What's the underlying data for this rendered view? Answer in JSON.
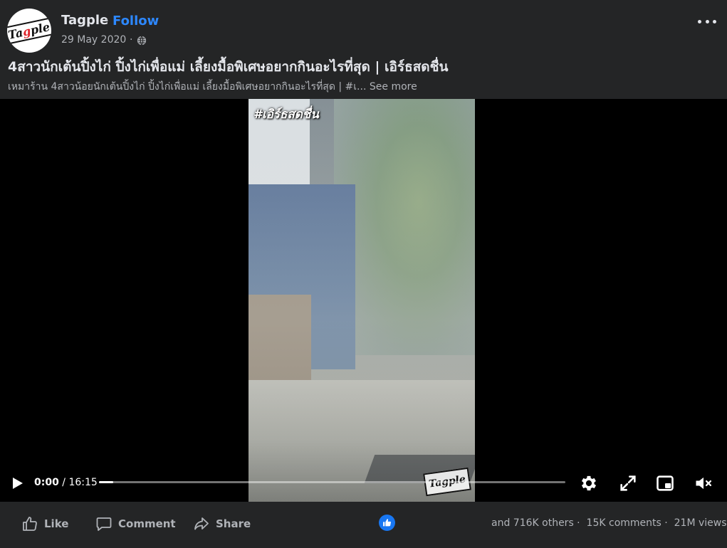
{
  "page": {
    "name": "Tagple",
    "name_separator": "·",
    "follow_label": "Follow",
    "date": "29 May 2020",
    "date_separator": "·",
    "avatar_logo_text": "Tagple"
  },
  "post": {
    "title": "4สาวนักเต้นปิ้งไก่ ปิ้งไก่เพื่อแม่ เลี้ยงมื้อพิเศษอยากกินอะไรที่สุด | เอิร์ธสดชื่น",
    "description": "เหมาร้าน 4สาวน้อยนักเต้นปิ้งไก่ ปิ้งไก่เพื่อแม่ เลี้ยงมื้อพิเศษอยากกินอะไรที่สุด | #เ...",
    "see_more": "See more"
  },
  "video": {
    "hashtag_overlay": "#เอิร์ธสดชื่น",
    "watermark_text": "Tagple",
    "current_time": "0:00",
    "time_separator": " / ",
    "duration": "16:15",
    "progress_fraction": 0.0,
    "buffered_fraction": 0.03
  },
  "actions": {
    "like_label": "Like",
    "comment_label": "Comment",
    "share_label": "Share"
  },
  "stats": {
    "reactions_text": "and 716K others",
    "comments_text": "15K comments",
    "views_text": "21M views"
  },
  "colors": {
    "background": "#242526",
    "accent_blue": "#2d88ff",
    "like_blue": "#1877f2",
    "text_primary": "#e4e6eb",
    "text_secondary": "#b0b3b8"
  },
  "icons": {
    "audience": "globe-icon",
    "more": "more-options-icon",
    "play": "play-icon",
    "settings": "gear-icon",
    "fullscreen": "fullscreen-icon",
    "pip": "picture-in-picture-icon",
    "mute": "muted-speaker-icon",
    "like": "thumbs-up-icon",
    "comment": "comment-bubble-icon",
    "share": "share-arrow-icon"
  }
}
